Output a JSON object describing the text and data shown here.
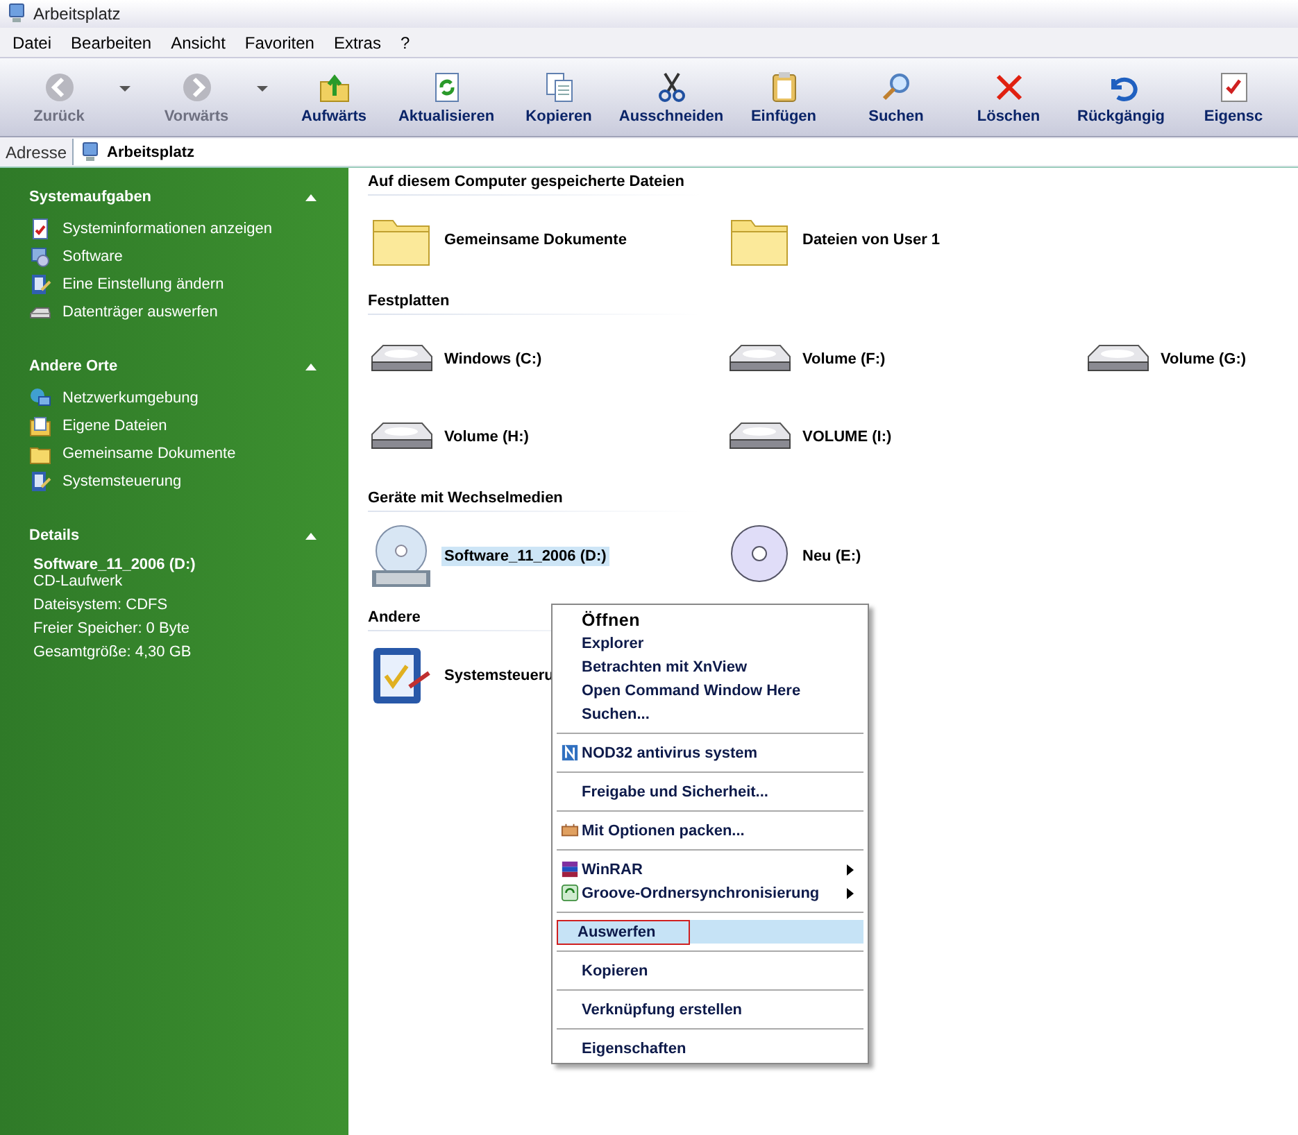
{
  "window": {
    "title": "Arbeitsplatz"
  },
  "menu_bar": [
    "Datei",
    "Bearbeiten",
    "Ansicht",
    "Favoriten",
    "Extras",
    "?"
  ],
  "toolbar": [
    {
      "label": "Zurück",
      "kind": "back",
      "disabled": true,
      "dropdown": true
    },
    {
      "label": "Vorwärts",
      "kind": "forward",
      "disabled": true,
      "dropdown": true
    },
    {
      "label": "Aufwärts",
      "kind": "up",
      "disabled": false,
      "dropdown": false
    },
    {
      "label": "Aktualisieren",
      "kind": "refresh",
      "disabled": false,
      "dropdown": false
    },
    {
      "label": "Kopieren",
      "kind": "copy",
      "disabled": false,
      "dropdown": false
    },
    {
      "label": "Ausschneiden",
      "kind": "cut",
      "disabled": false,
      "dropdown": false
    },
    {
      "label": "Einfügen",
      "kind": "paste",
      "disabled": false,
      "dropdown": false
    },
    {
      "label": "Suchen",
      "kind": "search",
      "disabled": false,
      "dropdown": false
    },
    {
      "label": "Löschen",
      "kind": "delete",
      "disabled": false,
      "dropdown": false
    },
    {
      "label": "Rückgängig",
      "kind": "undo",
      "disabled": false,
      "dropdown": false
    },
    {
      "label": "Eigensc",
      "kind": "properties",
      "disabled": false,
      "dropdown": false
    }
  ],
  "address_bar": {
    "label": "Adresse",
    "value": "Arbeitsplatz"
  },
  "sidebar": {
    "panels": [
      {
        "title": "Systemaufgaben",
        "expanded": true,
        "items": [
          {
            "label": "Systeminformationen anzeigen",
            "kind": "sysinfo"
          },
          {
            "label": "Software",
            "kind": "software"
          },
          {
            "label": "Eine Einstellung ändern",
            "kind": "settings"
          },
          {
            "label": "Datenträger auswerfen",
            "kind": "eject"
          }
        ]
      },
      {
        "title": "Andere Orte",
        "expanded": true,
        "items": [
          {
            "label": "Netzwerkumgebung",
            "kind": "network"
          },
          {
            "label": "Eigene Dateien",
            "kind": "documents"
          },
          {
            "label": "Gemeinsame Dokumente",
            "kind": "folder"
          },
          {
            "label": "Systemsteuerung",
            "kind": "settings"
          }
        ]
      },
      {
        "title": "Details",
        "expanded": true,
        "details": {
          "name": "Software_11_2006 (D:)",
          "lines": [
            "CD-Laufwerk",
            "Dateisystem: CDFS",
            "Freier Speicher: 0 Byte",
            "Gesamtgröße: 4,30 GB"
          ]
        }
      }
    ]
  },
  "sections": [
    {
      "title": "Auf diesem Computer gespeicherte Dateien",
      "items": [
        {
          "label": "Gemeinsame Dokumente",
          "kind": "folder",
          "selected": false
        },
        {
          "label": "Dateien von User 1",
          "kind": "folder",
          "selected": false
        }
      ]
    },
    {
      "title": "Festplatten",
      "items": [
        {
          "label": "Windows (C:)",
          "kind": "disk",
          "selected": false
        },
        {
          "label": "Volume (F:)",
          "kind": "disk",
          "selected": false
        },
        {
          "label": "Volume (G:)",
          "kind": "disk",
          "selected": false
        },
        {
          "label": "Volume (H:)",
          "kind": "disk",
          "selected": false
        },
        {
          "label": "VOLUME (I:)",
          "kind": "disk",
          "selected": false
        }
      ]
    },
    {
      "title": "Geräte mit Wechselmedien",
      "items": [
        {
          "label": "Software_11_2006 (D:)",
          "kind": "dvd",
          "selected": true
        },
        {
          "label": "Neu (E:)",
          "kind": "cd",
          "selected": false
        }
      ]
    },
    {
      "title": "Andere",
      "items": [
        {
          "label": "Systemsteueru",
          "kind": "control-panel",
          "selected": false
        }
      ]
    }
  ],
  "context_menu": {
    "groups": [
      [
        {
          "label": "Öffnen",
          "kind": "plain",
          "default": true,
          "submenu": false,
          "selected": false
        },
        {
          "label": "Explorer",
          "kind": "plain",
          "default": false,
          "submenu": false,
          "selected": false
        },
        {
          "label": "Betrachten mit XnView",
          "kind": "plain",
          "default": false,
          "submenu": false,
          "selected": false
        },
        {
          "label": "Open Command Window Here",
          "kind": "plain",
          "default": false,
          "submenu": false,
          "selected": false
        },
        {
          "label": "Suchen...",
          "kind": "plain",
          "default": false,
          "submenu": false,
          "selected": false
        }
      ],
      [
        {
          "label": "NOD32 antivirus system",
          "kind": "antivirus",
          "default": false,
          "submenu": false,
          "selected": false
        }
      ],
      [
        {
          "label": "Freigabe und Sicherheit...",
          "kind": "plain",
          "default": false,
          "submenu": false,
          "selected": false
        }
      ],
      [
        {
          "label": "Mit Optionen packen...",
          "kind": "pack",
          "default": false,
          "submenu": false,
          "selected": false
        }
      ],
      [
        {
          "label": "WinRAR",
          "kind": "archive",
          "default": false,
          "submenu": true,
          "selected": false
        },
        {
          "label": "Groove-Ordnersynchronisierung",
          "kind": "sync",
          "default": false,
          "submenu": true,
          "selected": false
        }
      ],
      [
        {
          "label": "Auswerfen",
          "kind": "plain",
          "default": false,
          "submenu": false,
          "selected": true
        }
      ],
      [
        {
          "label": "Kopieren",
          "kind": "plain",
          "default": false,
          "submenu": false,
          "selected": false
        }
      ],
      [
        {
          "label": "Verknüpfung erstellen",
          "kind": "plain",
          "default": false,
          "submenu": false,
          "selected": false
        }
      ],
      [
        {
          "label": "Eigenschaften",
          "kind": "plain",
          "default": false,
          "submenu": false,
          "selected": false
        }
      ]
    ]
  }
}
